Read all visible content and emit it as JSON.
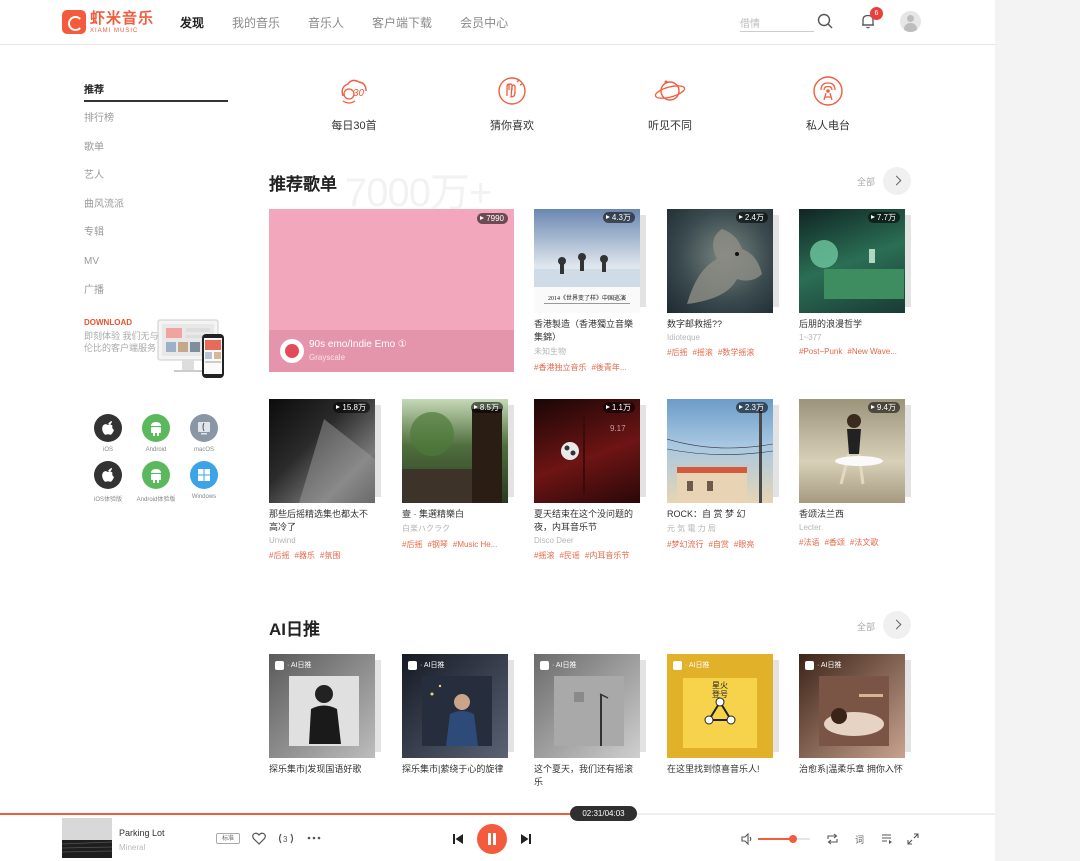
{
  "header": {
    "logo_cn": "虾米音乐",
    "logo_en": "XIAMI MUSIC",
    "nav": [
      "发现",
      "我的音乐",
      "音乐人",
      "客户端下载",
      "会员中心"
    ],
    "search_placeholder": "借情",
    "notification_count": "6"
  },
  "sidebar": {
    "items": [
      "推荐",
      "排行榜",
      "歌单",
      "艺人",
      "曲风流派",
      "专辑",
      "MV",
      "广播"
    ],
    "download": {
      "title": "DOWNLOAD",
      "desc": "即刻体验 我们无与伦比的客户端服务"
    },
    "platforms": [
      {
        "label": "iOS",
        "icon": "apple-icon",
        "color": "#333333"
      },
      {
        "label": "Android",
        "icon": "android-icon",
        "color": "#5cb85c"
      },
      {
        "label": "macOS",
        "icon": "macos-icon",
        "color": "#8a96a3"
      },
      {
        "label": "iOS体验版",
        "icon": "apple-icon",
        "color": "#333333"
      },
      {
        "label": "Android体验版",
        "icon": "android-icon",
        "color": "#5cb85c"
      },
      {
        "label": "Windows",
        "icon": "windows-icon",
        "color": "#3ba3e8"
      }
    ]
  },
  "quick_entries": [
    {
      "label": "每日30首",
      "icon": "daily-30-icon"
    },
    {
      "label": "猜你喜欢",
      "icon": "guess-like-icon"
    },
    {
      "label": "听见不同",
      "icon": "planet-icon"
    },
    {
      "label": "私人电台",
      "icon": "radio-icon"
    }
  ],
  "recommended": {
    "title": "推荐歌单",
    "bg_text": "7000万+",
    "all_label": "全部",
    "featured": {
      "title": "90s emo/Indie Emo ①",
      "sub": "Grayscale",
      "plays": "7990"
    },
    "playlists": [
      {
        "title": "香港製造（香港獨立音樂集錦）",
        "sub": "未知生物",
        "tags": [
          "#香港独立音乐",
          "#後青年..."
        ],
        "plays": "4.3万",
        "cover": [
          "#dfe6ee",
          "#3d5a8a"
        ],
        "cover_text": "2014《世界变了样》中国巡演"
      },
      {
        "title": "数字邮救摇??",
        "sub": "Idioteque",
        "tags": [
          "#后摇",
          "#摇滚",
          "#数学摇滚"
        ],
        "plays": "2.4万",
        "cover": [
          "#2c3a40",
          "#6d7a77"
        ]
      },
      {
        "title": "后朋的浪漫哲学",
        "sub": "1~377",
        "tags": [
          "#Post−Punk",
          "#New Wave..."
        ],
        "plays": "7.7万",
        "cover": [
          "#183a35",
          "#3f8c6a"
        ]
      },
      {
        "title": "那些后摇精选集也都太不高冷了",
        "sub": "Unwind",
        "tags": [
          "#后摇",
          "#器乐",
          "#氛围"
        ],
        "plays": "15.8万",
        "cover": [
          "#1a1a1a",
          "#6a6a6a"
        ]
      },
      {
        "title": "壹 · 集選精樂白",
        "sub": "白楽ハクラク",
        "tags": [
          "#后摇",
          "#钢琴",
          "#Music He..."
        ],
        "plays": "8.5万",
        "cover": [
          "#2f4a2a",
          "#9fb58e"
        ]
      },
      {
        "title": "夏天结束在这个没问题的夜，内耳音乐节",
        "sub": "Disco Deer",
        "tags": [
          "#摇滚",
          "#民谣",
          "#内耳音乐节"
        ],
        "plays": "1.1万",
        "cover": [
          "#3a0d0d",
          "#8a1d1d"
        ],
        "cover_text": "9.17"
      },
      {
        "title": "ROCK：自 赏 梦 幻",
        "sub": "元 気 電 力 局",
        "tags": [
          "#梦幻流行",
          "#自赏",
          "#眼亮"
        ],
        "plays": "2.3万",
        "cover": [
          "#8fb4d6",
          "#e0c9a0"
        ]
      },
      {
        "title": "香颂法兰西",
        "sub": "Lecter.",
        "tags": [
          "#法语",
          "#香颂",
          "#法文歌"
        ],
        "plays": "9.4万",
        "cover": [
          "#c9c2a8",
          "#7a6b52"
        ]
      }
    ]
  },
  "ai_daily": {
    "title": "AI日推",
    "all_label": "全部",
    "badge": "· AI日推",
    "items": [
      {
        "title": "探乐集市|发现国语好歌",
        "cover": [
          "#444444",
          "#bdbdbd"
        ]
      },
      {
        "title": "探乐集市|萦绕于心的旋律",
        "cover": [
          "#1c2230",
          "#5a6275"
        ]
      },
      {
        "title": "这个夏天，我们还有摇滚乐",
        "cover": [
          "#7c7c7c",
          "#c6c6c6"
        ]
      },
      {
        "title": "在这里找到惊喜音乐人!",
        "cover": [
          "#e2b12a",
          "#f4d04a"
        ],
        "cover_text": "星火 登号"
      },
      {
        "title": "治愈系|温柔乐章 拥你入怀",
        "cover": [
          "#5a3a2e",
          "#c9a28f"
        ]
      }
    ]
  },
  "player": {
    "track": "Parking Lot",
    "artist": "Mineral",
    "quality": "标准",
    "time": "02:31/04:03",
    "progress": 0.621,
    "volume": 0.68,
    "lyrics_label": "词"
  },
  "colors": {
    "accent": "#f35b3c"
  }
}
